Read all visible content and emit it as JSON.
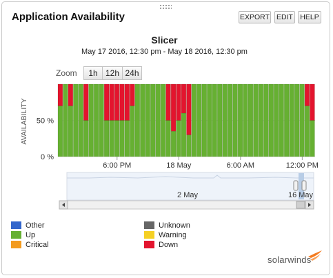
{
  "header": {
    "title": "Application Availability",
    "buttons": {
      "export": "EXPORT",
      "edit": "EDIT",
      "help": "HELP"
    }
  },
  "zoom": {
    "label": "Zoom",
    "options": [
      "1h",
      "12h",
      "24h"
    ]
  },
  "legend": [
    {
      "label": "Other",
      "color": "#3366cc"
    },
    {
      "label": "Unknown",
      "color": "#666666"
    },
    {
      "label": "Up",
      "color": "#66b032"
    },
    {
      "label": "Warning",
      "color": "#f5d024"
    },
    {
      "label": "Critical",
      "color": "#f39b1f"
    },
    {
      "label": "Down",
      "color": "#e3142e"
    }
  ],
  "navigator": {
    "labels": [
      "2 May",
      "16 May"
    ]
  },
  "brand": {
    "name": "solarwinds",
    "color": "#f47b20"
  },
  "chart_data": {
    "type": "bar",
    "stacked": true,
    "title": "Slicer",
    "subtitle": "May 17 2016, 12:30 pm - May 18 2016, 12:30 pm",
    "ylabel": "AVAILABILITY",
    "ylim": [
      0,
      100
    ],
    "yticks": [
      {
        "value": 0,
        "label": "0 %"
      },
      {
        "value": 50,
        "label": "50 %"
      }
    ],
    "xticks": [
      {
        "label": "6:00 PM",
        "index": 11
      },
      {
        "label": "18 May",
        "index": 23
      },
      {
        "label": "6:00 AM",
        "index": 35
      },
      {
        "label": "12:00 PM",
        "index": 47
      }
    ],
    "grid": true,
    "series": [
      {
        "name": "Up",
        "color": "#66b032",
        "values": [
          70,
          100,
          70,
          100,
          100,
          50,
          100,
          100,
          100,
          50,
          50,
          50,
          50,
          50,
          70,
          100,
          100,
          100,
          100,
          100,
          100,
          50,
          35,
          50,
          60,
          30,
          100,
          100,
          100,
          100,
          100,
          100,
          100,
          100,
          100,
          100,
          100,
          100,
          100,
          100,
          100,
          100,
          100,
          100,
          100,
          100,
          100,
          100,
          70,
          50
        ]
      },
      {
        "name": "Down",
        "color": "#e3142e",
        "values": [
          30,
          0,
          30,
          0,
          0,
          50,
          0,
          0,
          0,
          50,
          50,
          50,
          50,
          50,
          30,
          0,
          0,
          0,
          0,
          0,
          0,
          50,
          65,
          50,
          40,
          70,
          0,
          0,
          0,
          0,
          0,
          0,
          0,
          0,
          0,
          0,
          0,
          0,
          0,
          0,
          0,
          0,
          0,
          0,
          0,
          0,
          0,
          0,
          30,
          50
        ]
      }
    ]
  }
}
